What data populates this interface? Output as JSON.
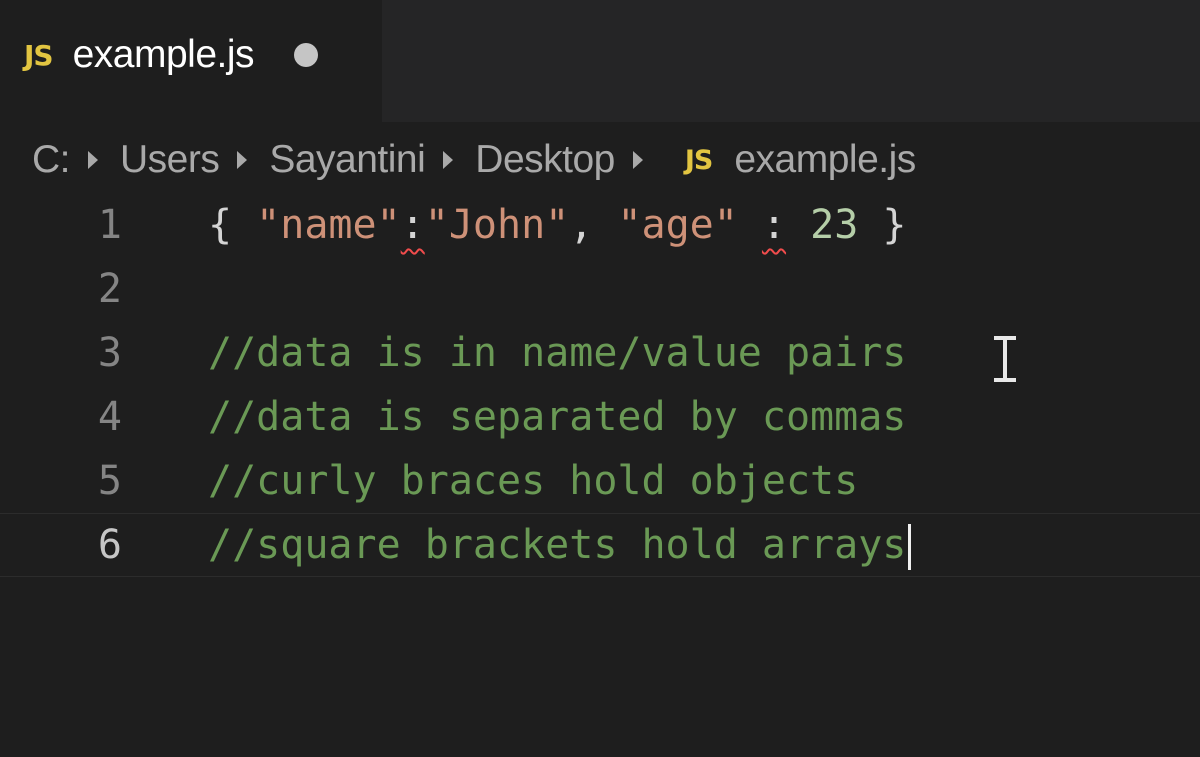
{
  "tab": {
    "icon": "JS",
    "title": "example.js",
    "dirty": true
  },
  "breadcrumb": {
    "items": [
      "C:",
      "Users",
      "Sayantini",
      "Desktop"
    ],
    "file_icon": "JS",
    "file": "example.js"
  },
  "editor": {
    "current_line": 6,
    "lines": [
      {
        "number": "1",
        "tokens": [
          {
            "text": "{ ",
            "kind": "brace"
          },
          {
            "text": "\"name\"",
            "kind": "str"
          },
          {
            "text": ":",
            "kind": "punc",
            "error": true
          },
          {
            "text": "\"John\"",
            "kind": "str"
          },
          {
            "text": ", ",
            "kind": "punc"
          },
          {
            "text": "\"age\"",
            "kind": "str"
          },
          {
            "text": " ",
            "kind": "punc"
          },
          {
            "text": ":",
            "kind": "punc",
            "error": true
          },
          {
            "text": " ",
            "kind": "punc"
          },
          {
            "text": "23",
            "kind": "num"
          },
          {
            "text": " }",
            "kind": "brace"
          }
        ]
      },
      {
        "number": "2",
        "tokens": []
      },
      {
        "number": "3",
        "tokens": [
          {
            "text": "//data is in name/value pairs",
            "kind": "comment"
          }
        ]
      },
      {
        "number": "4",
        "tokens": [
          {
            "text": "//data is separated by commas",
            "kind": "comment"
          }
        ]
      },
      {
        "number": "5",
        "tokens": [
          {
            "text": "//curly braces hold objects",
            "kind": "comment"
          }
        ]
      },
      {
        "number": "6",
        "tokens": [
          {
            "text": "//square brackets hold arrays",
            "kind": "comment"
          }
        ]
      }
    ]
  },
  "colors": {
    "background": "#1e1e1e",
    "tabbar": "#252526",
    "js_icon": "#e2c541",
    "string": "#ce9178",
    "number": "#b5cea8",
    "comment": "#6a9955",
    "error_squiggle": "#f14c4c"
  },
  "icons": {
    "tab_icon": "javascript-file-icon",
    "dirty": "unsaved-dot-icon",
    "separator": "chevron-right-icon",
    "pointer": "text-ibeam-cursor-icon"
  }
}
